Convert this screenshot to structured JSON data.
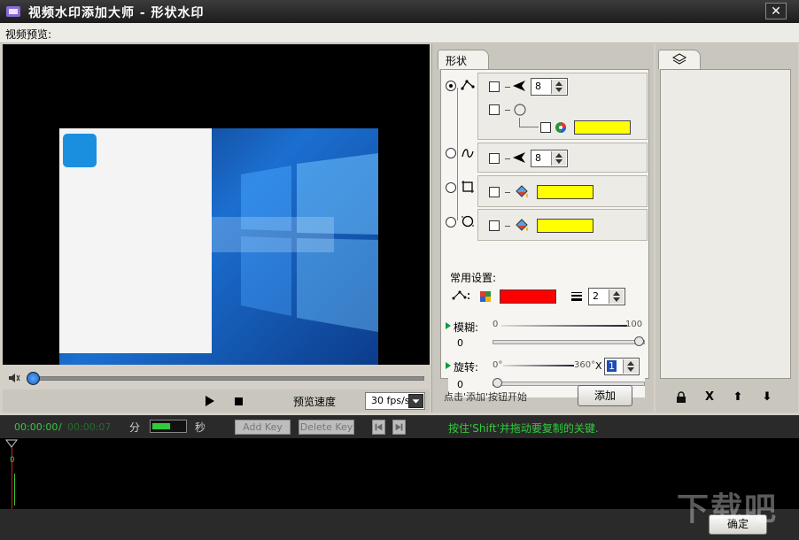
{
  "window": {
    "title": "视频水印添加大师 - 形状水印",
    "close_glyph": "✕"
  },
  "preview": {
    "label": "视频预览:"
  },
  "playback": {
    "speed_label": "预览速度",
    "fps_value": "30 fps/s"
  },
  "shape_panel": {
    "tab_label": "形状",
    "row1_size": "8",
    "row2_size": "8",
    "common_label": "常用设置:",
    "line_width": "2",
    "blur_label": "模糊:",
    "blur_min": "0",
    "blur_max": "100",
    "blur_value": "0",
    "rotate_label": "旋转:",
    "rotate_min": "0°",
    "rotate_max": "360°",
    "rotate_x": "X",
    "rotate_multiplier": "1",
    "rotate_value": "0",
    "hint": "点击'添加'按钮开始",
    "add_button": "添加"
  },
  "key_panel": {
    "lock_glyph": "🔒",
    "delete_glyph": "X",
    "up_glyph": "⬆",
    "down_glyph": "⬇"
  },
  "timeline": {
    "current_time": "00:00:00",
    "separator": "/",
    "total_time": "00:00:07",
    "min_label": "分",
    "sec_label": "秒",
    "add_key": "Add Key",
    "delete_key": "Delete Key",
    "shift_hint": "按住'Shift'并拖动要复制的关键.",
    "marker_value": "0"
  },
  "footer": {
    "ok_button": "确定",
    "watermark": "下载吧"
  },
  "colors": {
    "shape_fill": "#ffff00",
    "line_color": "#ff0000",
    "time_green": "#2ecc3a"
  }
}
